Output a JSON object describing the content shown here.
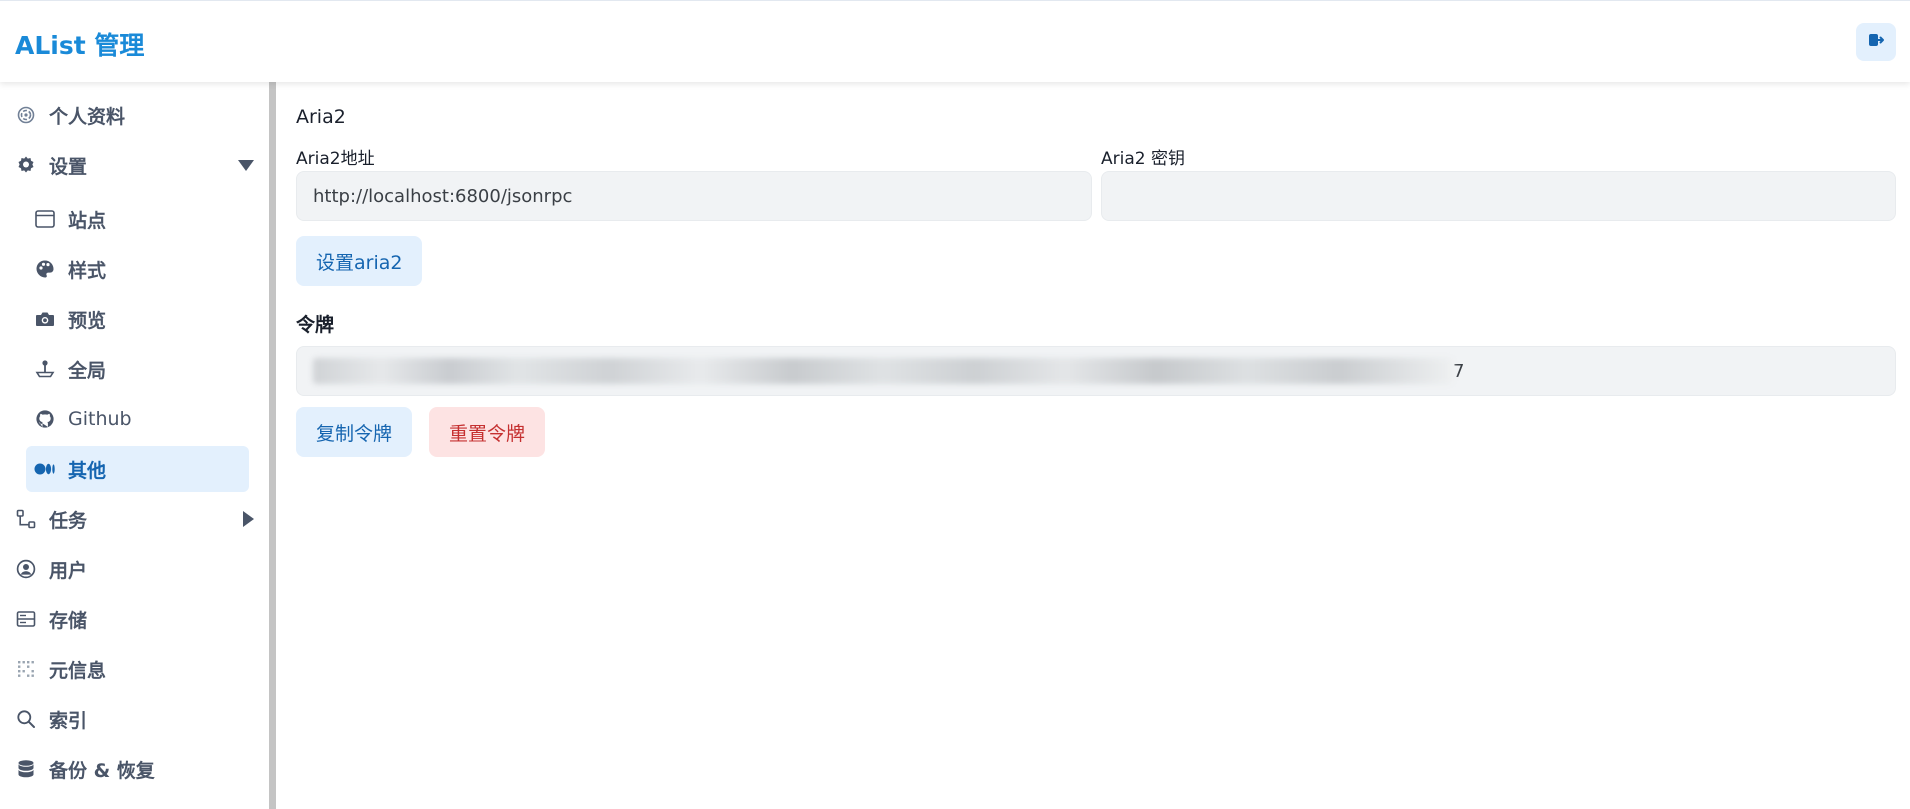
{
  "app": {
    "title": "AList 管理",
    "logout_icon": "logout-icon",
    "accent": "#1a8ad8"
  },
  "sidebar": {
    "items": [
      {
        "label": "个人资料",
        "icon": "fingerprint-icon"
      },
      {
        "label": "设置",
        "icon": "gear-icon",
        "expanded": true
      },
      {
        "label": "站点",
        "icon": "window-icon"
      },
      {
        "label": "样式",
        "icon": "palette-icon"
      },
      {
        "label": "预览",
        "icon": "camera-icon"
      },
      {
        "label": "全局",
        "icon": "joystick-icon"
      },
      {
        "label": "Github",
        "icon": "github-icon"
      },
      {
        "label": "其他",
        "icon": "medium-icon",
        "active": true
      },
      {
        "label": "任务",
        "icon": "flow-icon",
        "expanded": false
      },
      {
        "label": "用户",
        "icon": "user-circle-icon"
      },
      {
        "label": "存储",
        "icon": "storage-icon"
      },
      {
        "label": "元信息",
        "icon": "grid-dots-icon"
      },
      {
        "label": "索引",
        "icon": "search-icon"
      },
      {
        "label": "备份 & 恢复",
        "icon": "database-icon"
      }
    ]
  },
  "aria2": {
    "section_title": "Aria2",
    "url_label": "Aria2地址",
    "url_value": "http://localhost:6800/jsonrpc",
    "secret_label": "Aria2 密钥",
    "secret_value": "",
    "set_button": "设置aria2"
  },
  "token": {
    "section_title": "令牌",
    "value_suffix": "7",
    "copy_button": "复制令牌",
    "reset_button": "重置令牌"
  },
  "colors": {
    "button_blue_bg": "#e3f0fd",
    "button_blue_text": "#1565b0",
    "button_red_bg": "#fde3e3",
    "button_red_text": "#c53030"
  }
}
